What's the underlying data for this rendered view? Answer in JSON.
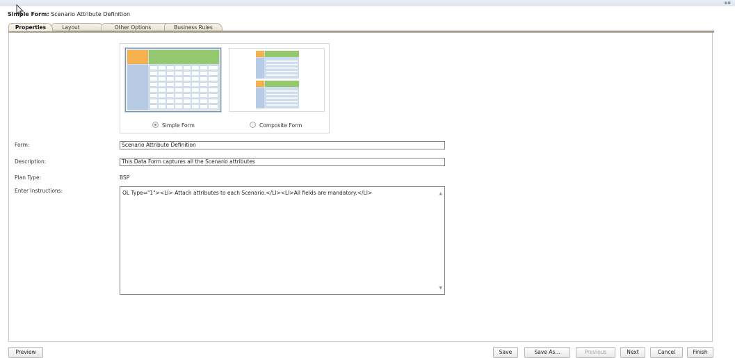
{
  "header": {
    "title_prefix": "Simple Form:",
    "title_name": "Scenario Attribute Definition"
  },
  "tabs": [
    {
      "label": "Properties",
      "active": true
    },
    {
      "label": "Layout",
      "active": false
    },
    {
      "label": "Other Options",
      "active": false
    },
    {
      "label": "Business Rules",
      "active": false
    }
  ],
  "layout_choice": {
    "simple_label": "Simple Form",
    "composite_label": "Composite Form",
    "selected": "Simple Form"
  },
  "form": {
    "form_label": "Form:",
    "form_value": "Scenario Attribute Definition",
    "description_label": "Description:",
    "description_value": "This Data Form captures all the Scenario attributes",
    "plan_type_label": "Plan Type:",
    "plan_type_value": "BSP",
    "instructions_label": "Enter Instructions:",
    "instructions_value": "OL Type=\"1\"><LI> Attach attributes to each Scenario.</LI><LI>All fields are mandatory.</LI>"
  },
  "footer": {
    "preview": "Preview",
    "save": "Save",
    "save_as": "Save As...",
    "previous": "Previous",
    "next": "Next",
    "cancel": "Cancel",
    "finish": "Finish"
  },
  "colors": {
    "thumb_orange": "#f5b14d",
    "thumb_green": "#93c86f",
    "thumb_blue": "#b8cbe4",
    "tab_rule": "#a59b88"
  }
}
